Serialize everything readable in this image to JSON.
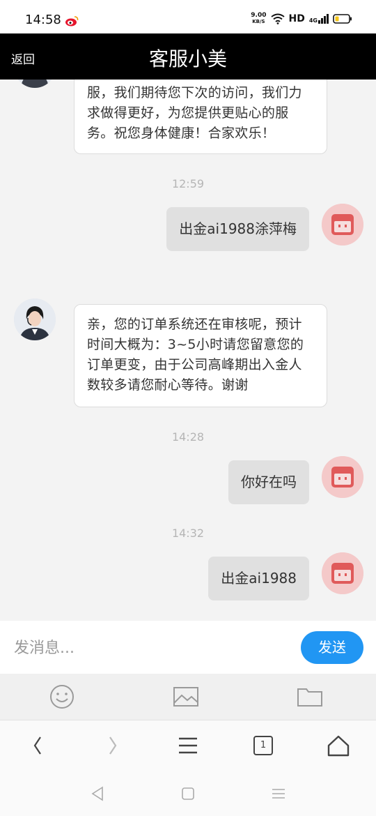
{
  "status_bar": {
    "time": "14:58",
    "speed_value": "9.00",
    "speed_unit": "KB/S",
    "hd": "HD",
    "network": "4G"
  },
  "header": {
    "back_label": "返回",
    "title": "客服小美"
  },
  "messages": [
    {
      "from": "agent",
      "text": "服，我们期待您下次的访问，我们力求做得更好，为您提供更贴心的服务。祝您身体健康！合家欢乐！"
    },
    {
      "type": "timestamp",
      "text": "12:59"
    },
    {
      "from": "user",
      "text": "出金ai1988涂萍梅"
    },
    {
      "from": "agent",
      "text": "亲，您的订单系统还在审核呢，预计时间大概为：3~5小时请您留意您的订单更变，由于公司高峰期出入金人数较多请您耐心等待。谢谢"
    },
    {
      "type": "timestamp",
      "text": "14:28"
    },
    {
      "from": "user",
      "text": "你好在吗"
    },
    {
      "type": "timestamp",
      "text": "14:32"
    },
    {
      "from": "user",
      "text": "出金ai1988"
    }
  ],
  "input": {
    "placeholder": "发消息...",
    "send_label": "发送"
  },
  "toolbar": {
    "icons": [
      "emoji-icon",
      "image-icon",
      "folder-icon"
    ]
  },
  "browser_nav": {
    "tab_count": "1"
  },
  "colors": {
    "header_bg": "#000000",
    "send_button": "#2196f3",
    "outgoing_bubble": "#e0e0e0",
    "incoming_bubble": "#ffffff"
  }
}
